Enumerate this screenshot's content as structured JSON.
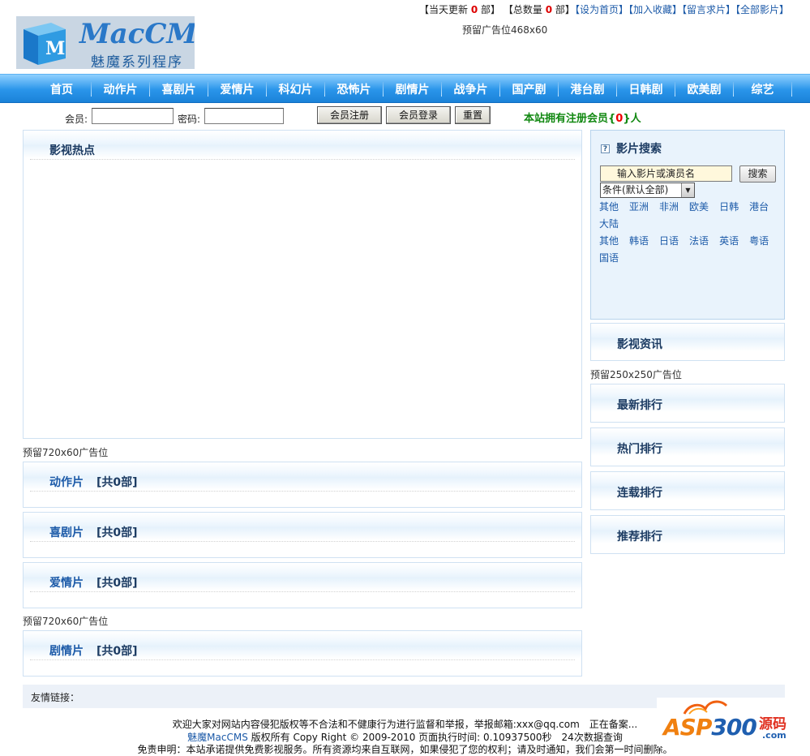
{
  "header": {
    "logo_title": "MacCMS",
    "logo_sub": "魅魔系列程序",
    "today_update_pre": "【当天更新",
    "today_update_count": "0",
    "today_update_suf": "部】",
    "total_pre": "【总数量",
    "total_count": "0",
    "total_suf": "部】",
    "links": [
      "【设为首页】",
      "【加入收藏】",
      "【留言求片】",
      "【全部影片】"
    ],
    "ad_468": "预留广告位468x60"
  },
  "nav": {
    "items": [
      "首页",
      "动作片",
      "喜剧片",
      "爱情片",
      "科幻片",
      "恐怖片",
      "剧情片",
      "战争片",
      "国产剧",
      "港台剧",
      "日韩剧",
      "欧美剧",
      "综艺"
    ]
  },
  "login": {
    "member_label": "会员:",
    "password_label": "密码:",
    "register_btn": "会员注册",
    "login_btn": "会员登录",
    "reset_btn": "重置",
    "members_pre": "本站拥有注册会员{",
    "members_count": "0",
    "members_suf": "}人"
  },
  "main": {
    "hot_title": "影视热点",
    "ad_720_1": "预留720x60广告位",
    "ad_720_2": "预留720x60广告位",
    "categories": [
      {
        "name": "动作片",
        "count": "[共0部]"
      },
      {
        "name": "喜剧片",
        "count": "[共0部]"
      },
      {
        "name": "爱情片",
        "count": "[共0部]"
      },
      {
        "name": "剧情片",
        "count": "[共0部]"
      }
    ]
  },
  "sidebar": {
    "search_title": "影片搜索",
    "search_help_icon": "?",
    "search_placeholder": "输入影片或演员名",
    "search_btn": "搜索",
    "condition_select": "条件(默认全部)",
    "regions_row1": [
      "其他",
      "亚洲",
      "非洲",
      "欧美",
      "日韩",
      "港台"
    ],
    "regions_row2": [
      "大陆"
    ],
    "langs_row1": [
      "其他",
      "韩语",
      "日语",
      "法语",
      "英语",
      "粤语"
    ],
    "langs_row2": [
      "国语"
    ],
    "news_title": "影视资讯",
    "ad_250": "预留250x250广告位",
    "rank_titles": [
      "最新排行",
      "热门排行",
      "连载排行",
      "推荐排行"
    ]
  },
  "footer": {
    "links_label": "友情链接：",
    "line1": "欢迎大家对网站内容侵犯版权等不合法和不健康行为进行监督和举报，举报邮箱:xxx@qq.com　正在备案...",
    "line2_brand": "魅魔MacCMS",
    "line2_rest": " 版权所有  Copy Right © 2009-2010 页面执行时间: 0.10937500秒　24次数据查询",
    "line3": "免责申明：本站承诺提供免费影视服务。所有资源均来自互联网，如果侵犯了您的权利；请及时通知，我们会第一时间删除。",
    "watermark_a": "ASP",
    "watermark_b": "300",
    "watermark_cn": "源码",
    "watermark_com": ".com"
  }
}
